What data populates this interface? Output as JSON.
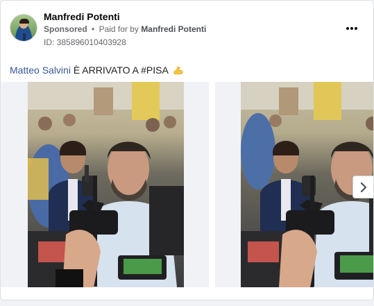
{
  "ad": {
    "page_name": "Manfredi Potenti",
    "sponsored_label": "Sponsored",
    "separator": "•",
    "paid_for_prefix": "Paid for by",
    "paid_for_name": "Manfredi Potenti",
    "ad_id": "ID: 385896010403928",
    "message_link": "Matteo Salvini",
    "message_text": " È ARRIVATO A #PISA",
    "emoji_icon": "flexed-biceps-icon"
  },
  "carousel": {
    "slide_count_visible": 2,
    "next_icon": "chevron-right-icon"
  },
  "colors": {
    "link": "#385898",
    "muted": "#65676b",
    "background": "#f0f2f5"
  }
}
